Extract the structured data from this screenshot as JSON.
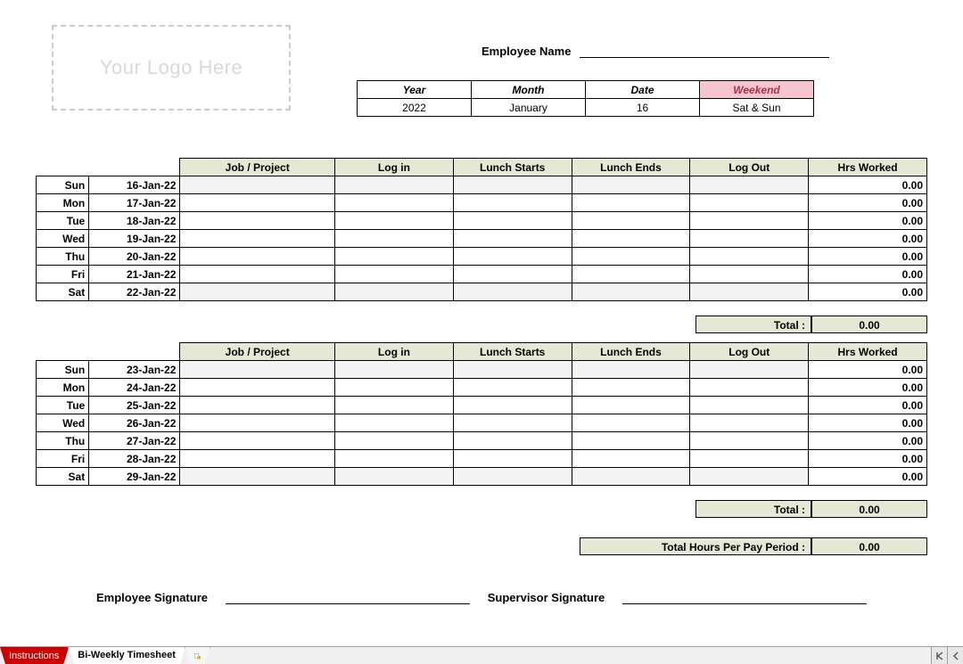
{
  "logo_placeholder": "Your Logo Here",
  "employee_name_label": "Employee Name",
  "meta": {
    "headers": {
      "year": "Year",
      "month": "Month",
      "date": "Date",
      "weekend": "Weekend"
    },
    "values": {
      "year": "2022",
      "month": "January",
      "date": "16",
      "weekend": "Sat & Sun"
    }
  },
  "columns": {
    "job": "Job / Project",
    "login": "Log in",
    "lunch_start": "Lunch Starts",
    "lunch_end": "Lunch Ends",
    "logout": "Log Out",
    "hrs": "Hrs Worked"
  },
  "week1": {
    "rows": [
      {
        "day": "Sun",
        "date": "16-Jan-22",
        "hrs": "0.00"
      },
      {
        "day": "Mon",
        "date": "17-Jan-22",
        "hrs": "0.00"
      },
      {
        "day": "Tue",
        "date": "18-Jan-22",
        "hrs": "0.00"
      },
      {
        "day": "Wed",
        "date": "19-Jan-22",
        "hrs": "0.00"
      },
      {
        "day": "Thu",
        "date": "20-Jan-22",
        "hrs": "0.00"
      },
      {
        "day": "Fri",
        "date": "21-Jan-22",
        "hrs": "0.00"
      },
      {
        "day": "Sat",
        "date": "22-Jan-22",
        "hrs": "0.00"
      }
    ],
    "total_label": "Total :",
    "total_value": "0.00"
  },
  "week2": {
    "rows": [
      {
        "day": "Sun",
        "date": "23-Jan-22",
        "hrs": "0.00"
      },
      {
        "day": "Mon",
        "date": "24-Jan-22",
        "hrs": "0.00"
      },
      {
        "day": "Tue",
        "date": "25-Jan-22",
        "hrs": "0.00"
      },
      {
        "day": "Wed",
        "date": "26-Jan-22",
        "hrs": "0.00"
      },
      {
        "day": "Thu",
        "date": "27-Jan-22",
        "hrs": "0.00"
      },
      {
        "day": "Fri",
        "date": "28-Jan-22",
        "hrs": "0.00"
      },
      {
        "day": "Sat",
        "date": "29-Jan-22",
        "hrs": "0.00"
      }
    ],
    "total_label": "Total :",
    "total_value": "0.00"
  },
  "pay_period": {
    "label": "Total Hours Per Pay Period :",
    "value": "0.00"
  },
  "signatures": {
    "employee": "Employee Signature",
    "supervisor": "Supervisor Signature"
  },
  "tabs": {
    "instructions": "Instructions",
    "biweekly": "Bi-Weekly Timesheet"
  }
}
